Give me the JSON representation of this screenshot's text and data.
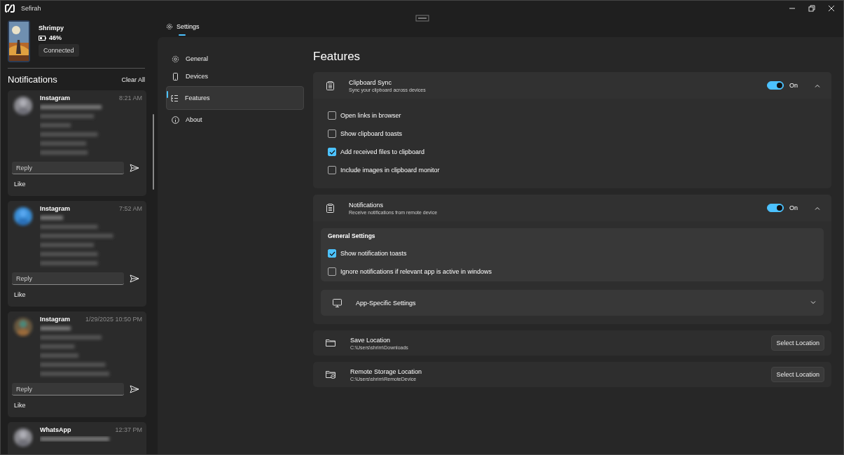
{
  "window": {
    "title": "Sefirah"
  },
  "device": {
    "name": "Shrimpy",
    "battery": "46%",
    "status": "Connected"
  },
  "notifications": {
    "title": "Notifications",
    "clear": "Clear All",
    "items": [
      {
        "app": "Instagram",
        "time": "8:21 AM",
        "reply_placeholder": "Reply",
        "action": "Like"
      },
      {
        "app": "Instagram",
        "time": "7:52 AM",
        "reply_placeholder": "Reply",
        "action": "Like"
      },
      {
        "app": "Instagram",
        "time": "1/29/2025 10:50 PM",
        "reply_placeholder": "Reply",
        "action": "Like"
      },
      {
        "app": "WhatsApp",
        "time": "12:37 PM"
      }
    ]
  },
  "tabs": [
    {
      "label": "Settings",
      "selected": true
    }
  ],
  "nav": [
    {
      "label": "General",
      "selected": false
    },
    {
      "label": "Devices",
      "selected": false
    },
    {
      "label": "Features",
      "selected": true
    },
    {
      "label": "About",
      "selected": false
    }
  ],
  "page": {
    "title": "Features",
    "cards": [
      {
        "kind": "expander",
        "title": "Clipboard Sync",
        "subtitle": "Sync your clipboard across devices",
        "toggle": {
          "on": true,
          "label": "On"
        },
        "expanded": true,
        "options": [
          {
            "label": "Open links in browser",
            "checked": false
          },
          {
            "label": "Show clipboard toasts",
            "checked": false
          },
          {
            "label": "Add received files to clipboard",
            "checked": true
          },
          {
            "label": "Include images in clipboard monitor",
            "checked": false
          }
        ]
      },
      {
        "kind": "expander",
        "title": "Notifications",
        "subtitle": "Receive notifications from remote device",
        "toggle": {
          "on": true,
          "label": "On"
        },
        "expanded": true,
        "group": {
          "title": "General Settings",
          "options": [
            {
              "label": "Show notification toasts",
              "checked": true
            },
            {
              "label": "Ignore notifications if relevant app is active in windows",
              "checked": false
            }
          ]
        },
        "sub": {
          "title": "App-Specific Settings",
          "expanded": false
        }
      },
      {
        "kind": "location",
        "title": "Save Location",
        "path": "C:\\Users\\shrim\\Downloads",
        "button": "Select Location"
      },
      {
        "kind": "location",
        "title": "Remote Storage Location",
        "path": "C:\\Users\\shrim\\RemoteDevice",
        "button": "Select Location"
      }
    ]
  }
}
